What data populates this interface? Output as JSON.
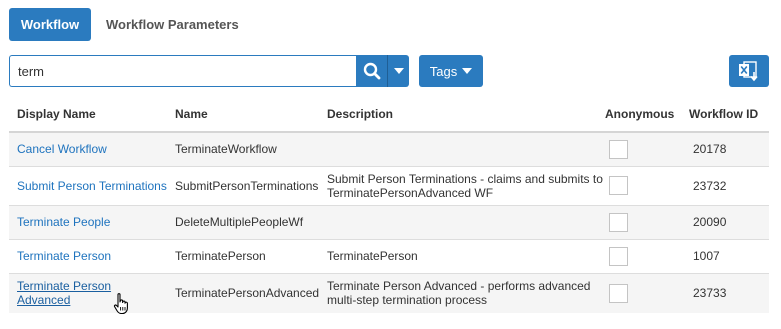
{
  "tabs": [
    {
      "label": "Workflow",
      "active": true
    },
    {
      "label": "Workflow Parameters",
      "active": false
    }
  ],
  "search": {
    "value": "term",
    "icon": "search-icon"
  },
  "tags_button": {
    "label": "Tags"
  },
  "export_button": {
    "icon": "excel-export-icon"
  },
  "table": {
    "columns": [
      "Display Name",
      "Name",
      "Description",
      "Anonymous",
      "Workflow ID"
    ],
    "rows": [
      {
        "display_name": "Cancel Workflow",
        "name": "TerminateWorkflow",
        "description": "",
        "anonymous": false,
        "workflow_id": "20178"
      },
      {
        "display_name": "Submit Person Terminations",
        "name": "SubmitPersonTerminations",
        "description": "Submit Person Terminations - claims and submits to TerminatePersonAdvanced WF",
        "anonymous": false,
        "workflow_id": "23732"
      },
      {
        "display_name": "Terminate People",
        "name": "DeleteMultiplePeopleWf",
        "description": "",
        "anonymous": false,
        "workflow_id": "20090"
      },
      {
        "display_name": "Terminate Person",
        "name": "TerminatePerson",
        "description": "TerminatePerson",
        "anonymous": false,
        "workflow_id": "1007"
      },
      {
        "display_name": "Terminate Person Advanced",
        "name": "TerminatePersonAdvanced",
        "description": "Terminate Person Advanced - performs advanced multi-step termination process",
        "anonymous": false,
        "workflow_id": "23733"
      }
    ]
  },
  "colors": {
    "accent": "#2b7bbf",
    "link": "#1e73be"
  }
}
